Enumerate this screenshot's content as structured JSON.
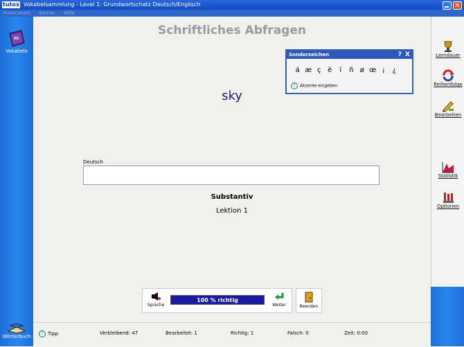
{
  "window": {
    "logo": "tutox",
    "title": "Vokabelsammlung - Level 1: Grundwortschatz Deutsch/Englisch",
    "close_glyph": "×"
  },
  "menu": [
    "Funktionen",
    "Extras",
    "Hilfe"
  ],
  "leftbar": {
    "vocab_label": "Vokabeln",
    "dictionary_label": "Wörterbuch"
  },
  "rightbar": {
    "items": [
      {
        "label": "Lerndauer",
        "icon": "trophy-icon"
      },
      {
        "label": "Reihenfolge",
        "icon": "cycle-arrows-icon"
      },
      {
        "label": "Bearbeiten",
        "icon": "pencil-icon"
      },
      {
        "label": "Statistik",
        "icon": "chart-icon"
      },
      {
        "label": "Optionen",
        "icon": "sliders-icon"
      }
    ]
  },
  "main": {
    "heading": "Schriftliches Abfragen",
    "word": "sky",
    "field_label": "Deutsch",
    "answer_value": "",
    "word_type": "Substantiv",
    "lesson": "Lektion 1"
  },
  "special_chars": {
    "title": "Sonderzeichen",
    "help": "?",
    "close": "X",
    "chars": [
      "á",
      "æ",
      "ç",
      "ë",
      "ï",
      "ñ",
      "ø",
      "œ",
      "¡",
      "¿"
    ],
    "hint": "Akzente eingeben"
  },
  "controls": {
    "speaker_label": "Sprache",
    "progress_text": "100 % richtig",
    "progress_fraction": 1.0,
    "next_label": "Weiter",
    "exit_label": "Beenden"
  },
  "status": {
    "tip": "Tipp",
    "remaining": "Verbleibend: 47",
    "processed": "Bearbeitet: 1",
    "correct": "Richtig: 1",
    "wrong": "Falsch: 0",
    "time": "Zeit: 0:00"
  },
  "colors": {
    "accent": "#2d57b8",
    "word": "#1c1c8c",
    "progress": "#1a1aa0"
  }
}
